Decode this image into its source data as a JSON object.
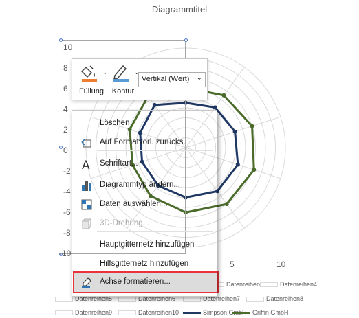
{
  "chart": {
    "title": "Diagrammtitel",
    "y_ticks": [
      "10",
      "8",
      "6",
      "4",
      "2",
      "0",
      "-2",
      "-4",
      "-6",
      "-8",
      "-10"
    ],
    "x_ticks": [
      "5",
      "10"
    ]
  },
  "chart_data": {
    "type": "line",
    "subtype": "radar",
    "title": "Diagrammtitel",
    "vertical_axis_range": [
      -10,
      10
    ],
    "series": [
      {
        "name": "Simpson GmbH",
        "color": "#1f3864",
        "values": [
          4.5,
          5.0,
          5.2,
          5.5,
          5.4,
          5.0,
          4.7,
          4.6,
          4.8,
          5.3
        ]
      },
      {
        "name": "Griffin GmbH",
        "color": "#4a6b2a",
        "values": [
          6.0,
          6.5,
          7.0,
          7.2,
          7.0,
          6.5,
          6.0,
          5.6,
          5.9,
          6.4
        ]
      }
    ]
  },
  "legend": {
    "items": [
      {
        "label": "Datenreihen3",
        "style": "swatch"
      },
      {
        "label": "Datenreihen4",
        "style": "swatch"
      },
      {
        "label": "Datenreihen5",
        "style": "swatch"
      },
      {
        "label": "Datenreihen6",
        "style": "swatch"
      },
      {
        "label": "Datenreihen7",
        "style": "swatch"
      },
      {
        "label": "Datenreihen8",
        "style": "swatch"
      },
      {
        "label": "Datenreihen9",
        "style": "swatch"
      },
      {
        "label": "Datenreihen10",
        "style": "swatch"
      },
      {
        "label": "Simpson GmbH",
        "style": "line",
        "color": "#1f3864"
      },
      {
        "label": "Griffin GmbH",
        "style": "line",
        "color": "#4a6b2a"
      }
    ]
  },
  "mini_toolbar": {
    "fill_label": "Füllung",
    "outline_label": "Kontur",
    "element_select_value": "Vertikal (Wert)",
    "fill_color": "#ed7d31",
    "outline_color": "#5b9bd5"
  },
  "context_menu": {
    "items": [
      {
        "label": "Löschen",
        "icon": "none",
        "enabled": true
      },
      {
        "label": "Auf Formatvorl. zurücks.",
        "icon": "reset-style-icon",
        "enabled": true
      },
      {
        "label": "Schriftart...",
        "icon": "font-icon",
        "enabled": true
      },
      {
        "label": "Diagrammtyp ändern...",
        "icon": "chart-type-icon",
        "enabled": true
      },
      {
        "label": "Daten auswählen...",
        "icon": "select-data-icon",
        "enabled": true
      },
      {
        "label": "3D-Drehung...",
        "icon": "rotation-3d-icon",
        "enabled": false
      },
      {
        "label": "Hauptgitternetz hinzufügen",
        "icon": "none",
        "enabled": true
      },
      {
        "label": "Hilfsgitternetz hinzufügen",
        "icon": "none",
        "enabled": true
      },
      {
        "label": "Achse formatieren...",
        "icon": "format-axis-icon",
        "enabled": true,
        "highlighted": true
      }
    ]
  }
}
